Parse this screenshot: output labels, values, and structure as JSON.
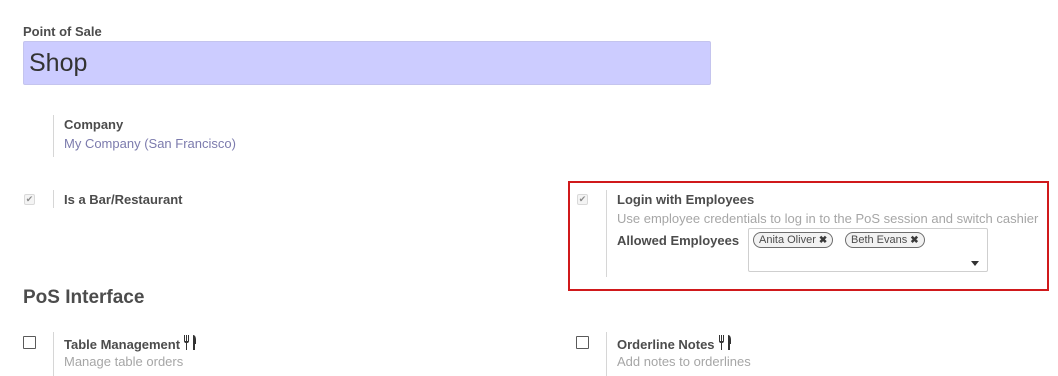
{
  "header": {
    "label": "Point of Sale",
    "name_value": "Shop"
  },
  "company": {
    "label": "Company",
    "value": "My Company (San Francisco)"
  },
  "bar_restaurant": {
    "label": "Is a Bar/Restaurant",
    "checked": true
  },
  "login_employees": {
    "label": "Login with Employees",
    "description": "Use employee credentials to log in to the PoS session and switch cashier",
    "checked": true,
    "allowed_label": "Allowed Employees",
    "tags": [
      {
        "name": "Anita Oliver"
      },
      {
        "name": "Beth Evans"
      }
    ]
  },
  "pos_interface": {
    "title": "PoS Interface",
    "table_management": {
      "label": "Table Management",
      "description": "Manage table orders",
      "icon": "cutlery-icon",
      "checked": false
    },
    "orderline_notes": {
      "label": "Orderline Notes",
      "description": "Add notes to orderlines",
      "icon": "cutlery-icon",
      "checked": false
    }
  },
  "colors": {
    "highlight": "#d0191b",
    "input_bg": "#ccccff",
    "link": "#7c7bad"
  }
}
